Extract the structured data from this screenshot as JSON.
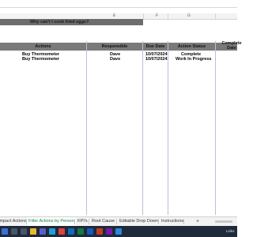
{
  "columns": [
    "E",
    "F",
    "G"
  ],
  "sheet_title": "Why can't I cook fried eggs?",
  "table": {
    "headers": {
      "actions": "Actions",
      "responsible": "Responsible",
      "due_date": "Due Date",
      "action_status": "Action Status",
      "completed_line1": "Complete",
      "completed_line2": "Date"
    },
    "rows": [
      {
        "action": "Buy Thermometer",
        "responsible": "Dave",
        "due_date": "10/07/2024",
        "status": "Complete"
      },
      {
        "action": "Buy Thermometer",
        "responsible": "Dave",
        "due_date": "10/07/2024",
        "status": "Work In Progress"
      }
    ]
  },
  "sheet_tabs": [
    {
      "label": "Impact Actions",
      "active": false
    },
    {
      "label": "Filter Actions by Person",
      "active": true
    },
    {
      "label": "KPI's",
      "active": false
    },
    {
      "label": "Root Cause",
      "active": false
    },
    {
      "label": "Editable Drop Down",
      "active": false
    },
    {
      "label": "Instructions",
      "active": false
    }
  ],
  "add_tab_label": "+",
  "taskbar": {
    "tray_text": "Links",
    "icons": [
      "search-icon",
      "task-view-icon",
      "file-explorer-icon",
      "teams-icon",
      "edge-icon",
      "chrome-icon",
      "mail-icon",
      "excel-icon",
      "word-icon",
      "powerpoint-icon",
      "onenote-icon",
      "app-icon"
    ]
  },
  "colors": {
    "header_fill": "#7a7a7a",
    "title_fill": "#6d6d6d",
    "active_tab": "#107c41",
    "taskbar": "#1f2a3a"
  }
}
